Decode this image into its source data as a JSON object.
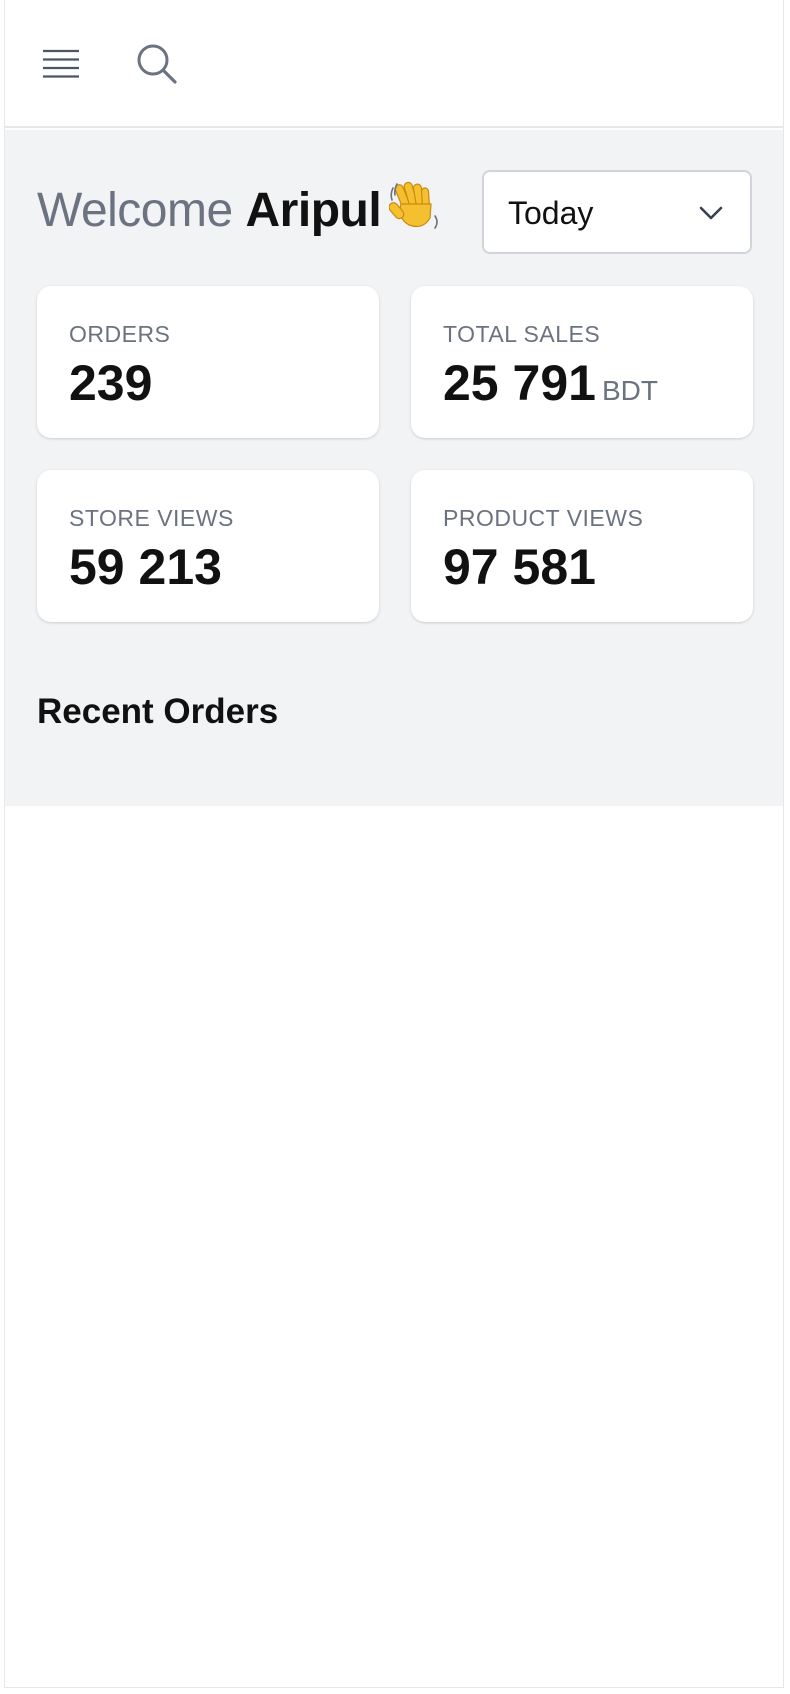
{
  "header": {
    "menu_icon": "menu-icon",
    "search_icon": "search-icon"
  },
  "welcome": {
    "greeting": "Welcome",
    "name": "Aripul",
    "emoji": "waving-hand-icon"
  },
  "period_select": {
    "value": "Today",
    "icon": "chevron-down-icon"
  },
  "stats": [
    {
      "label": "ORDERS",
      "value": "239",
      "unit": ""
    },
    {
      "label": "TOTAL SALES",
      "value": "25 791",
      "unit": "BDT"
    },
    {
      "label": "STORE VIEWS",
      "value": "59 213",
      "unit": ""
    },
    {
      "label": "PRODUCT VIEWS",
      "value": "97 581",
      "unit": ""
    }
  ],
  "recent_orders": {
    "title": "Recent Orders"
  },
  "colors": {
    "background_gray": "#f2f3f5",
    "muted_text": "#6b7280",
    "primary_text": "#111111",
    "card_bg": "#ffffff"
  }
}
